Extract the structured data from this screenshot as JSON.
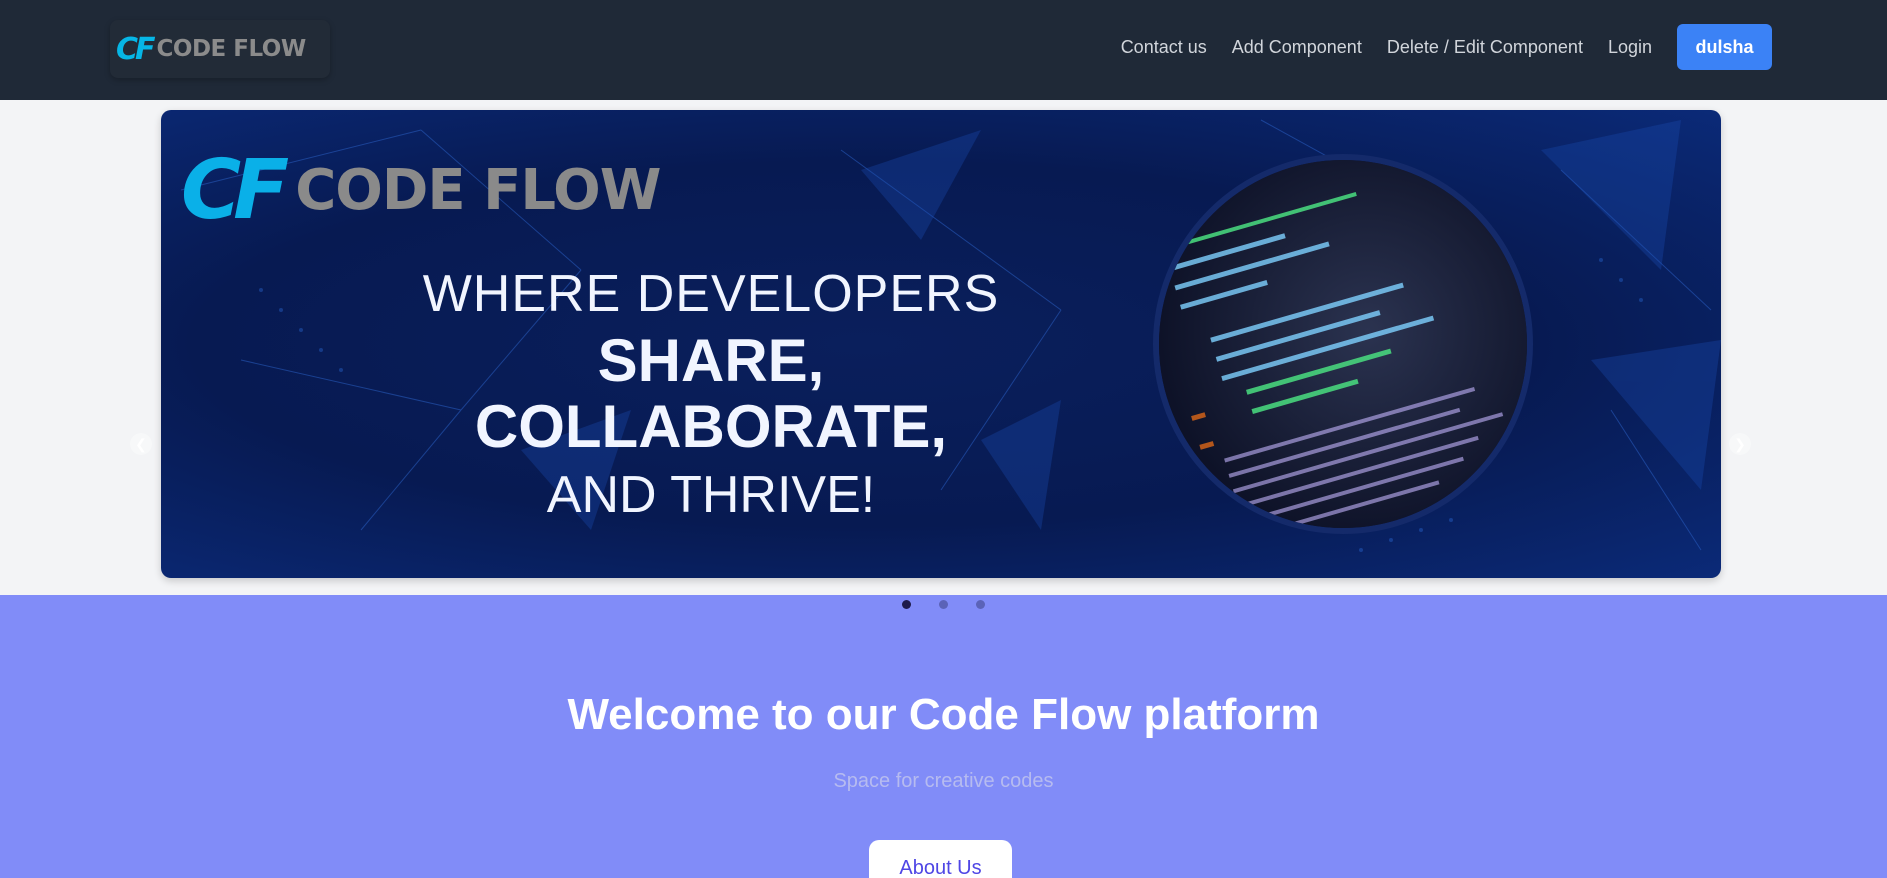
{
  "brand": {
    "cf_mark": "CF",
    "name": "CODE FLOW"
  },
  "nav": {
    "links": [
      "Contact us",
      "Add Component",
      "Delete / Edit Component",
      "Login"
    ],
    "user_button": "dulsha"
  },
  "hero": {
    "logo_cf": "CF",
    "logo_text": "CODE FLOW",
    "line1": "WHERE DEVELOPERS",
    "line2": "SHARE, COLLABORATE,",
    "line3": "AND THRIVE!",
    "prev_icon": "chevron-left-icon",
    "next_icon": "chevron-right-icon",
    "slide_count": 3,
    "active_slide": 1
  },
  "welcome": {
    "title": "Welcome to our Code Flow platform",
    "subtitle": "Space for creative codes",
    "about_button": "About Us"
  },
  "colors": {
    "navbar": "#1f2937",
    "accent": "#3b82f6",
    "welcome_bg": "#818cf8",
    "about_text": "#4f46e5"
  }
}
